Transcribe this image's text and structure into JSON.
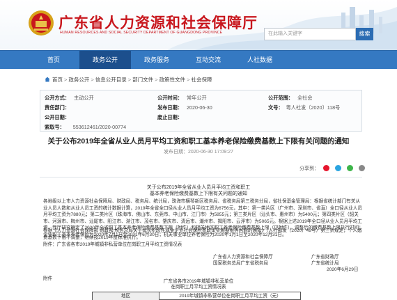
{
  "header": {
    "site_title": "广东省人力资源和社会保障厅",
    "site_subtitle": "HUMAN RESOURCES AND SOCIAL SECURITY DEPARTMENT OF GUANGDONG PROVINCE",
    "search_placeholder": "在此输入关键字",
    "search_button": "搜索"
  },
  "nav": {
    "items": [
      "首页",
      "政务公开",
      "政务服务",
      "互动交流",
      "人社数据"
    ]
  },
  "breadcrumb": [
    "首页",
    "政务公开",
    "信息公开目录",
    "部门文件",
    "政策性文件",
    "社会保障"
  ],
  "info": {
    "rows": [
      [
        {
          "label": "公开方式：",
          "value": "主动公开"
        },
        {
          "label": "公开时间：",
          "value": "常年公开"
        },
        {
          "label": "公开范围：",
          "value": "全社会"
        }
      ],
      [
        {
          "label": "责任部门：",
          "value": ""
        },
        {
          "label": "发布日期：",
          "value": "2020-06-30"
        },
        {
          "label": "文号：",
          "value": "粤人社发〔2020〕118号"
        }
      ],
      [
        {
          "label": "公开日期：",
          "value": ""
        },
        {
          "label": "废止日期：",
          "value": ""
        },
        {
          "label": "",
          "value": ""
        }
      ],
      [
        {
          "label": "索取号：",
          "value": "553612461/2020-00774"
        },
        {
          "label": "",
          "value": ""
        },
        {
          "label": "",
          "value": ""
        }
      ]
    ]
  },
  "article": {
    "title": "关于公布2019年全省从业人员月平均工资和职工基本养老保险缴费基数上下限有关问题的通知",
    "meta": "发布日期：2020-06-30 17:09:27",
    "share_label": "分享到：",
    "doc_title_1": "关于公布2019年全省从业人员月平均工资和职工",
    "doc_title_2": "基本养老保险缴费基数上下限有关问题的通知",
    "paragraph_1": "各地级以上市人力资源社会保障局、财政局、税务局、统计局，珠海市横琴新区税务局、省税务局第三税务分局，省社保基金管理局：根据省统计部门有关从业人员人数和从业人员工资的统计数据计算，2019年全省全口径从业人员月平均工资为6756元，其中：第一类片区（广州市、深圳市、省直）全口径从业人员月平均工资为7880元；第二类片区（珠海市、佛山市、东莞市、中山市、江门市）为5855元；第三类片区（汕头市、惠州市）为5400元；第四类片区（韶关市、河源市、梅州市、汕尾市、阳江市、湛江市、茂名市、肇庆市、清远市、潮州市、揭阳市、云浮市）为5065元。根据上述2019年全口径从业人员月平均工资，我厅研究确定了2020年全省职工基本养老保险缴费基数下限（附件）和相关地区职工养老保险缴费基数上限（见附件），调整后的缴费基数上限执行时间：企业职工基本养老保险为2020年7月1日至2021年6月30日；机关事业单位养老保险为2020年1月1日至2020年12月31日。",
    "paragraph_2": "根据《人力资源社会保障部 财政部 税务总局关于延长阶段性减免企业社会保险费政策实施期限等问题的通知》（人社部发〔2020〕49号）第三条规定，个人缴费基数下限不调整，继续按2019年度标准执行。",
    "attachment_line": "附件：广东省各市2019年城镇非私营单位在岗职工月平均工资情况表",
    "sign_left_1": "广东省人力资源和社会保障厅",
    "sign_left_2": "国家税务总局广东省税务局",
    "sign_right_1": "广东省财政厅",
    "sign_right_2": "广东省统计局",
    "sign_date": "2020年6月29日",
    "attach_label": "附件",
    "table_caption_1": "广东省各市2019年城镇非私营单位",
    "table_caption_2": "在岗职工月平均工资情况表",
    "table_col_1": "地区",
    "table_col_2": "2019年城镇非私营单位在岗职工月平均工资（元）"
  },
  "colors": {
    "brand_red": "#c8161d",
    "nav_blue": "#3579c2",
    "nav_active": "#1c4f8d"
  }
}
